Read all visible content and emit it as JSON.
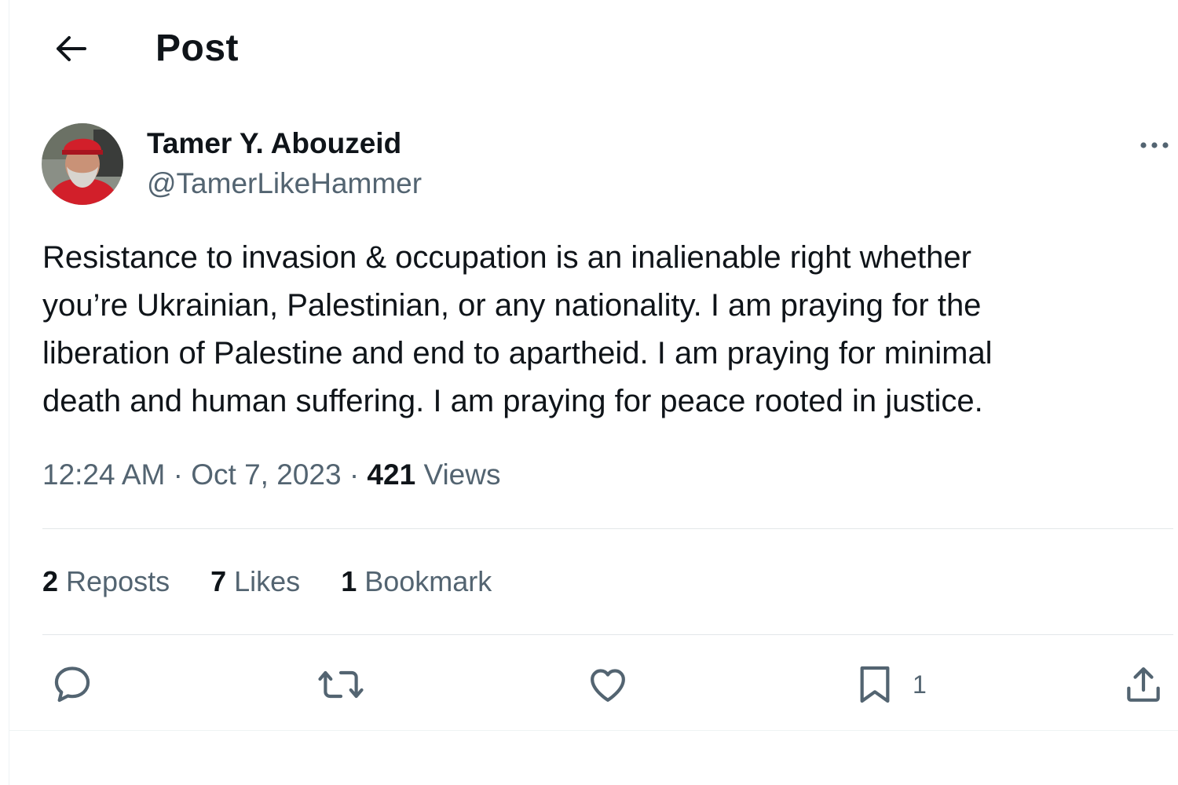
{
  "header": {
    "title": "Post",
    "back_icon": "arrow-left-icon"
  },
  "author": {
    "display_name": "Tamer Y. Abouzeid",
    "handle": "@TamerLikeHammer"
  },
  "post": {
    "text_lines": [
      "Resistance to invasion & occupation is an inalienable right whether",
      "you’re Ukrainian, Palestinian, or any nationality. I am praying for the",
      "liberation of Palestine and end to apartheid. I am praying for minimal",
      "death and human suffering. I am praying for peace rooted in justice."
    ],
    "time": "12:24 AM",
    "date": "Oct 7, 2023",
    "separator": "·",
    "views_count": "421",
    "views_label": "Views"
  },
  "stats": {
    "reposts": {
      "count": "2",
      "label": "Reposts"
    },
    "likes": {
      "count": "7",
      "label": "Likes"
    },
    "bookmarks": {
      "count": "1",
      "label": "Bookmark"
    }
  },
  "actions": {
    "bookmark_count": "1",
    "icons": [
      "reply-icon",
      "repost-icon",
      "like-icon",
      "bookmark-icon",
      "share-icon"
    ]
  },
  "colors": {
    "text": "#0f1419",
    "secondary": "#536471",
    "divider": "#e3e7e9"
  }
}
